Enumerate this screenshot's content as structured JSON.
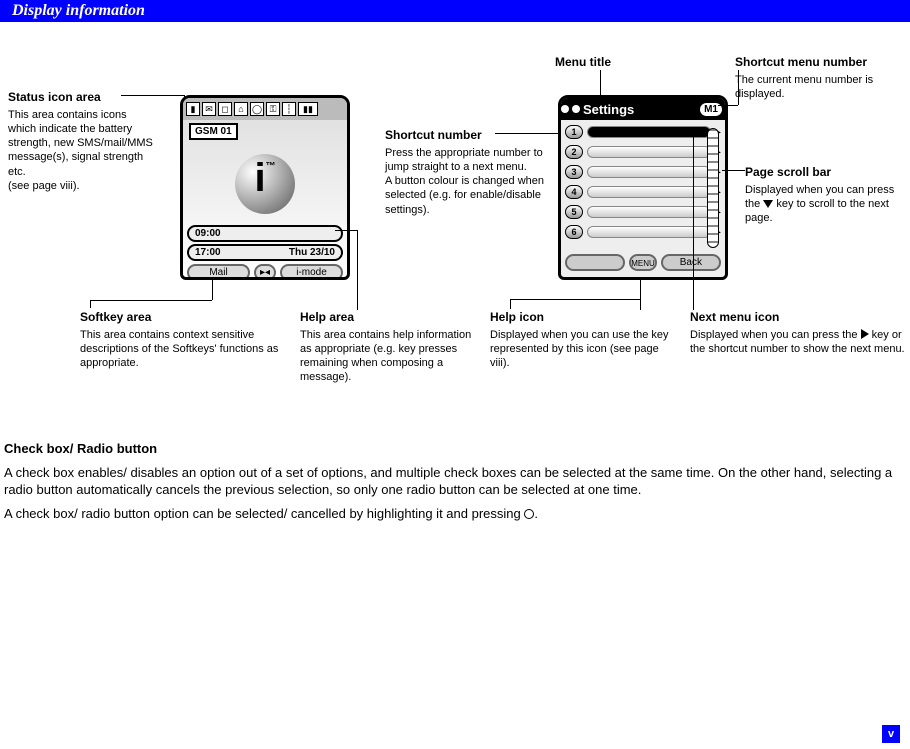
{
  "header": {
    "title": "Display information"
  },
  "callouts": {
    "status_icon": {
      "title": "Status icon area",
      "body": "This area contains icons which indicate the battery strength, new SMS/mail/MMS message(s), signal strength etc.\n(see page viii)."
    },
    "softkey": {
      "title": "Softkey area",
      "body": "This area contains context sensitive descriptions of the Softkeys' functions as appropriate."
    },
    "help_area": {
      "title": "Help area",
      "body": "This area contains help information as appropriate (e.g. key presses remaining when composing a message)."
    },
    "menu_title": {
      "title": "Menu title"
    },
    "shortcut_number": {
      "title": "Shortcut number",
      "body": "Press the appropriate number to jump straight to a next menu.\nA button colour is changed when selected (e.g. for enable/disable settings)."
    },
    "shortcut_menu_number": {
      "title": "Shortcut menu number",
      "body": "The current menu number is displayed."
    },
    "page_scroll": {
      "title": "Page scroll bar",
      "body_pre": "Displayed when you can press the ",
      "body_post": " key to scroll to the next page."
    },
    "help_icon": {
      "title": "Help icon",
      "body": "Displayed when you can use the key represented by this icon (see page viii)."
    },
    "next_menu": {
      "title": "Next menu icon",
      "body_pre": "Displayed when you can press the ",
      "body_post": " key or the shortcut number to show the next menu."
    }
  },
  "phone1": {
    "gsm": "GSM 01",
    "clock1_left": "09:00",
    "clock1_right": "",
    "clock2_left": "17:00",
    "clock2_right": "Thu 23/10",
    "softkeys": {
      "left": "Mail",
      "mid": "▸◂",
      "right": "i-mode"
    }
  },
  "phone2": {
    "title": "Settings",
    "menu_num": "M1",
    "items": [
      "1",
      "2",
      "3",
      "4",
      "5",
      "6"
    ],
    "softkeys": {
      "left": "",
      "mid": "MENU",
      "right": "Back"
    }
  },
  "lower": {
    "heading": "Check box/ Radio button",
    "p1": "A check box enables/ disables an option out of a set of options, and multiple check boxes can be selected at the same time. On the other hand, selecting a radio button automatically cancels the previous selection, so only one radio button can be selected at one time.",
    "p2_pre": "A check box/ radio button option can be selected/ cancelled by highlighting it and pressing ",
    "p2_post": "."
  },
  "page_number": "v"
}
